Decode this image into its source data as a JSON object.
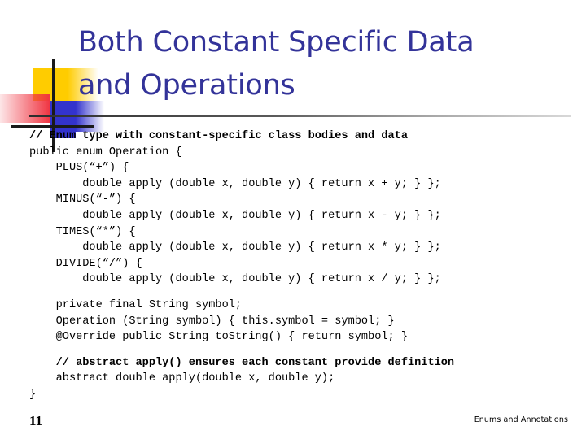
{
  "slide": {
    "title": "Both Constant Specific Data\nand Operations",
    "title_color": "#333399",
    "page_number": "11",
    "footer_note": "Enums and Annotations",
    "decoration": {
      "yellow": "#FFCC00",
      "blue": "#3333CC",
      "red": "#F03340",
      "crosshair": "#1A1A1A"
    }
  },
  "code": {
    "lines": [
      {
        "text": "// Enum type with constant-specific class bodies and data",
        "bold": true
      },
      {
        "text": "public enum Operation {",
        "bold": false
      },
      {
        "text": "    PLUS(“+”) {",
        "bold": false
      },
      {
        "text": "        double apply (double x, double y) { return x + y; } };",
        "bold": false
      },
      {
        "text": "    MINUS(“-”) {",
        "bold": false
      },
      {
        "text": "        double apply (double x, double y) { return x - y; } };",
        "bold": false
      },
      {
        "text": "    TIMES(“*”) {",
        "bold": false
      },
      {
        "text": "        double apply (double x, double y) { return x * y; } };",
        "bold": false
      },
      {
        "text": "    DIVIDE(“/”) {",
        "bold": false
      },
      {
        "text": "        double apply (double x, double y) { return x / y; } };",
        "bold": false
      },
      {
        "text": "",
        "bold": false,
        "blank": true
      },
      {
        "text": "    private final String symbol;",
        "bold": false
      },
      {
        "text": "    Operation (String symbol) { this.symbol = symbol; }",
        "bold": false
      },
      {
        "text": "    @Override public String toString() { return symbol; }",
        "bold": false
      },
      {
        "text": "",
        "bold": false,
        "blank": true
      },
      {
        "text": "    // abstract apply() ensures each constant provide definition",
        "bold": true
      },
      {
        "text": "    abstract double apply(double x, double y);",
        "bold": false
      },
      {
        "text": "}",
        "bold": false
      }
    ]
  }
}
